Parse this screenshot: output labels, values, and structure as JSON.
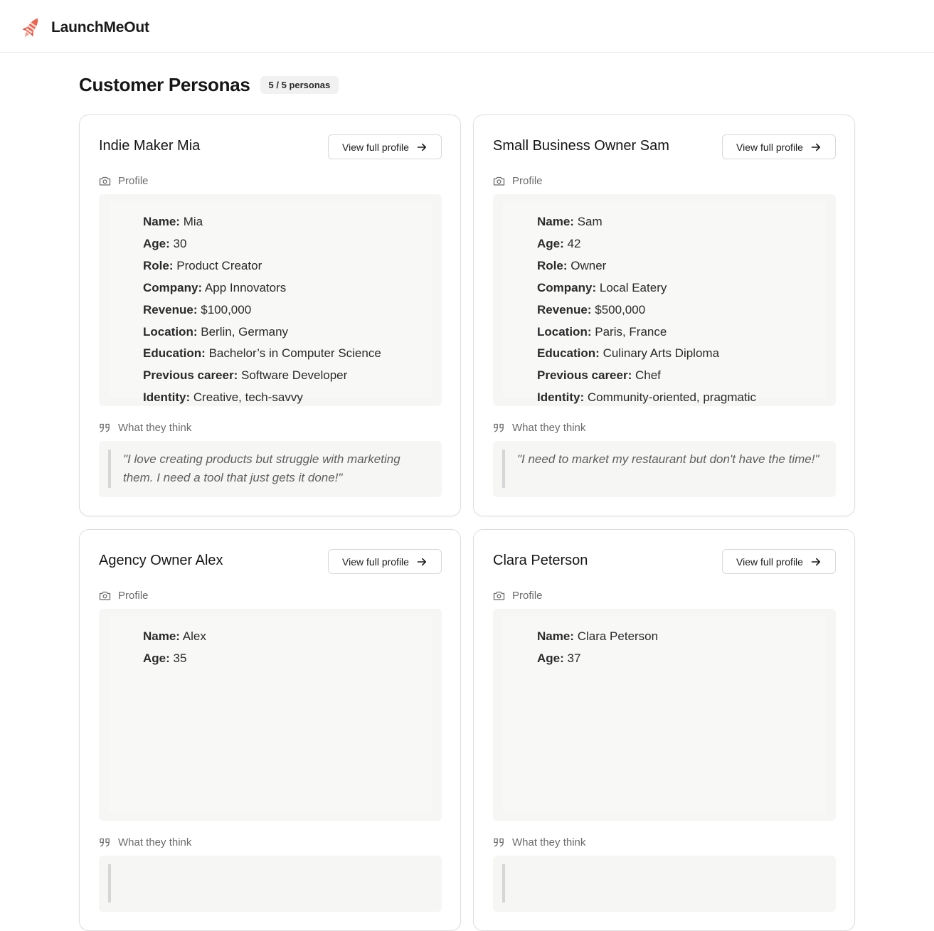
{
  "app": {
    "name": "LaunchMeOut",
    "logo_icon": "rocket-icon"
  },
  "page": {
    "title": "Customer Personas",
    "count_badge": "5 / 5 personas"
  },
  "labels": {
    "view_profile": "View full profile",
    "profile_section": "Profile",
    "think_section": "What they think"
  },
  "colors": {
    "brand_accent": "#f0624f",
    "quote_bar": "#d6d6d6",
    "box_bg": "#f6f6f5"
  },
  "personas": [
    {
      "title": "Indie Maker Mia",
      "fields": [
        {
          "key": "Name:",
          "value": "Mia"
        },
        {
          "key": "Age:",
          "value": "30"
        },
        {
          "key": "Role:",
          "value": "Product Creator"
        },
        {
          "key": "Company:",
          "value": "App Innovators"
        },
        {
          "key": "Revenue:",
          "value": "$100,000"
        },
        {
          "key": "Location:",
          "value": "Berlin, Germany"
        },
        {
          "key": "Education:",
          "value": "Bachelor’s in Computer Science"
        },
        {
          "key": "Previous career:",
          "value": "Software Developer"
        },
        {
          "key": "Identity:",
          "value": "Creative, tech-savvy"
        }
      ],
      "quote": "\"I love creating products but struggle with marketing them. I need a tool that just gets it done!\""
    },
    {
      "title": "Small Business Owner Sam",
      "fields": [
        {
          "key": "Name:",
          "value": "Sam"
        },
        {
          "key": "Age:",
          "value": "42"
        },
        {
          "key": "Role:",
          "value": "Owner"
        },
        {
          "key": "Company:",
          "value": "Local Eatery"
        },
        {
          "key": "Revenue:",
          "value": "$500,000"
        },
        {
          "key": "Location:",
          "value": "Paris, France"
        },
        {
          "key": "Education:",
          "value": "Culinary Arts Diploma"
        },
        {
          "key": "Previous career:",
          "value": "Chef"
        },
        {
          "key": "Identity:",
          "value": "Community-oriented, pragmatic"
        }
      ],
      "quote": "\"I need to market my restaurant but don't have the time!\""
    },
    {
      "title": "Agency Owner Alex",
      "fields": [
        {
          "key": "Name:",
          "value": "Alex"
        },
        {
          "key": "Age:",
          "value": "35"
        }
      ],
      "quote": ""
    },
    {
      "title": "Clara Peterson",
      "fields": [
        {
          "key": "Name:",
          "value": "Clara Peterson"
        },
        {
          "key": "Age:",
          "value": "37"
        }
      ],
      "quote": ""
    }
  ]
}
